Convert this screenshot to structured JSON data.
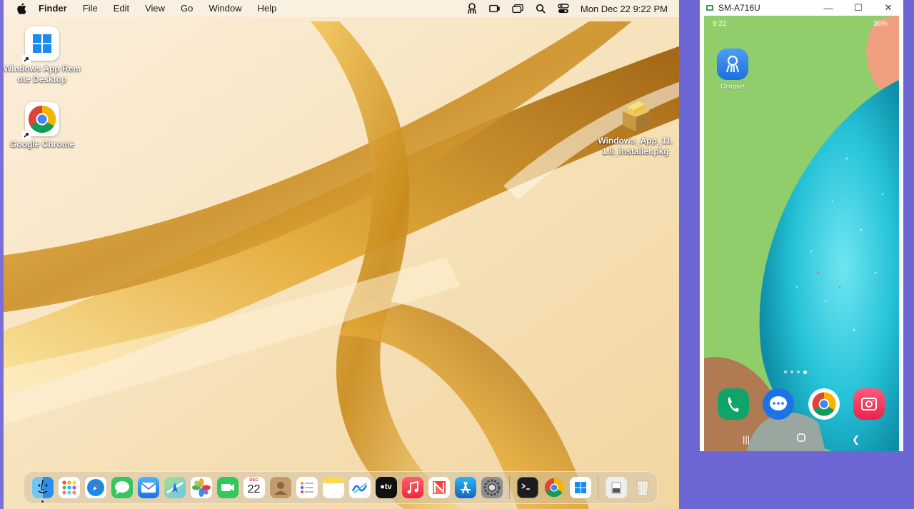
{
  "menubar": {
    "app_name": "Finder",
    "menus": [
      "File",
      "Edit",
      "View",
      "Go",
      "Window",
      "Help"
    ],
    "clock": "Mon Dec 22  9:22 PM"
  },
  "desktop": {
    "icons": [
      {
        "label": "Windows App Remote Desktop"
      },
      {
        "label": "Google Chrome"
      },
      {
        "label": "Windows_App_11.1.8_installer.pkg"
      }
    ]
  },
  "dock": {
    "calendar_day": "22",
    "calendar_month": "DEC",
    "apps": [
      "finder",
      "launchpad",
      "safari",
      "messages",
      "mail",
      "maps",
      "photos",
      "facetime",
      "calendar",
      "contacts",
      "reminders",
      "notes",
      "freeform",
      "tv",
      "music",
      "news",
      "app-store",
      "system-settings",
      "terminal",
      "chrome",
      "windows-app",
      "downloads",
      "trash"
    ]
  },
  "phone": {
    "window_title": "SM-A716U",
    "status_left": "9:22",
    "status_right": "36%",
    "apps": [
      {
        "label": "Octopus"
      }
    ]
  },
  "colors": {
    "background": "#6d67d6",
    "phone_green": "#8fce6a"
  }
}
